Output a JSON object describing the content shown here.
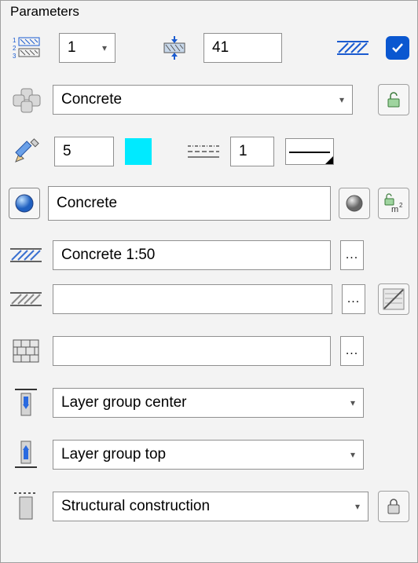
{
  "panel": {
    "title": "Parameters"
  },
  "row1": {
    "layer_select": "1",
    "thickness_value": "41"
  },
  "row2": {
    "material_select": "Concrete"
  },
  "row3": {
    "pen_value": "5",
    "linetype_value": "1"
  },
  "row4": {
    "surface_value": "Concrete"
  },
  "row5": {
    "hatch_scale_value": "Concrete 1:50",
    "ellipsis": "..."
  },
  "row6": {
    "hatch2_value": "",
    "ellipsis": "..."
  },
  "row7": {
    "pattern_value": "",
    "ellipsis": "..."
  },
  "row8": {
    "group_center_select": "Layer group center"
  },
  "row9": {
    "group_top_select": "Layer group top"
  },
  "row10": {
    "structural_select": "Structural construction"
  }
}
